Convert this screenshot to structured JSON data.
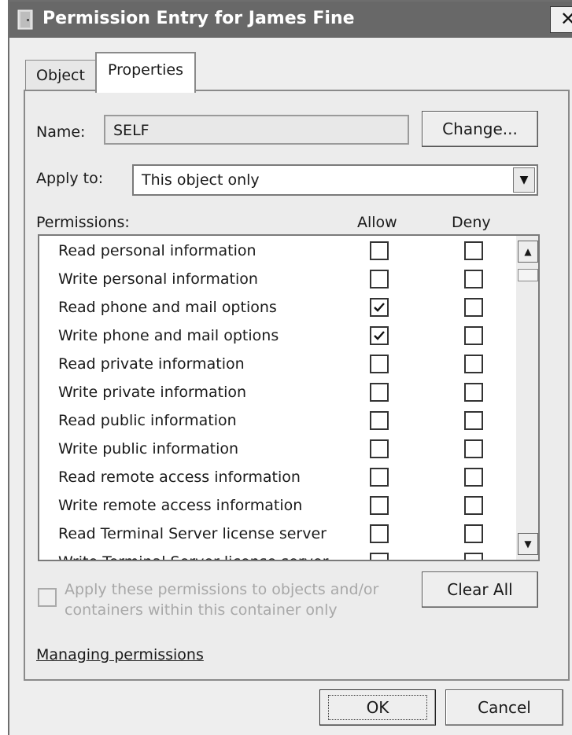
{
  "window": {
    "title": "Permission Entry for James Fine",
    "close_glyph": "✕"
  },
  "tabs": [
    {
      "label": "Object",
      "selected": false
    },
    {
      "label": "Properties",
      "selected": true
    }
  ],
  "name": {
    "label": "Name:",
    "value": "SELF",
    "change_button": "Change..."
  },
  "apply_to": {
    "label": "Apply to:",
    "value": "This object only"
  },
  "permissions": {
    "label": "Permissions:",
    "allow_header": "Allow",
    "deny_header": "Deny",
    "rows": [
      {
        "name": "Read personal information",
        "allow": false,
        "deny": false
      },
      {
        "name": "Write personal information",
        "allow": false,
        "deny": false
      },
      {
        "name": "Read phone and mail options",
        "allow": true,
        "deny": false
      },
      {
        "name": "Write phone and mail options",
        "allow": true,
        "deny": false
      },
      {
        "name": "Read private information",
        "allow": false,
        "deny": false
      },
      {
        "name": "Write private information",
        "allow": false,
        "deny": false
      },
      {
        "name": "Read public information",
        "allow": false,
        "deny": false
      },
      {
        "name": "Write public information",
        "allow": false,
        "deny": false
      },
      {
        "name": "Read remote access information",
        "allow": false,
        "deny": false
      },
      {
        "name": "Write remote access information",
        "allow": false,
        "deny": false
      },
      {
        "name": "Read Terminal Server license server",
        "allow": false,
        "deny": false
      },
      {
        "name": "Write Terminal Server license server",
        "allow": false,
        "deny": false
      }
    ]
  },
  "apply_inherit": {
    "text": "Apply these permissions to objects and/or containers within this container only",
    "checked": false,
    "enabled": false
  },
  "buttons": {
    "clear_all": "Clear All",
    "ok": "OK",
    "cancel": "Cancel"
  },
  "link": {
    "managing_permissions": "Managing permissions"
  },
  "icons": {
    "title": "door-icon",
    "check": "checkmark-icon",
    "scroll_up": "arrow-up-icon",
    "scroll_down": "arrow-down-icon",
    "dropdown": "chevron-down-icon"
  },
  "colors": {
    "titlebar": "#686868",
    "dialog_bg": "#eeeeee",
    "disabled_text": "#a8a8a8"
  }
}
